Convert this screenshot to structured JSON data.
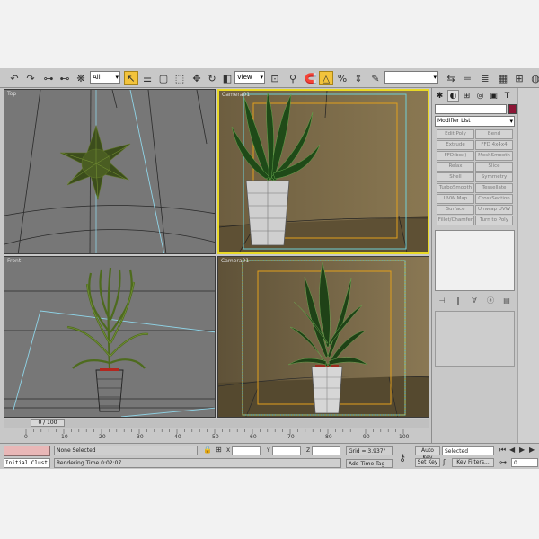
{
  "toolbar": {
    "selection_filter": "All",
    "reference_coord": "View",
    "named_selection": ""
  },
  "viewports": {
    "top": "Top",
    "camera_top": "Camera01",
    "front": "Front",
    "camera_bottom": "Camera01"
  },
  "command_panel": {
    "object_name": "",
    "modifier_list": "Modifier List",
    "modifier_buttons": [
      "Edit Poly",
      "Bend",
      "Extrude",
      "FFD 4x4x4",
      "FFD(box)",
      "MeshSmooth",
      "Relax",
      "Slice",
      "Shell",
      "Symmetry",
      "TurboSmooth",
      "Tessellate",
      "UVW Map",
      "CrossSection",
      "Surface",
      "Unwrap UVW",
      "Fillet/Chamfer",
      "Turn to Poly"
    ]
  },
  "timeline": {
    "frame_readout": "0 / 100",
    "ruler_ticks": [
      "0",
      "10",
      "20",
      "30",
      "40",
      "50",
      "60",
      "70",
      "80",
      "90",
      "100"
    ]
  },
  "status": {
    "selection_info": "None Selected",
    "prompt": "Rendering Time  0:02:07",
    "command_line": "Initial Clust",
    "x_label": "X",
    "y_label": "Y",
    "z_label": "Z",
    "x_value": "",
    "y_value": "",
    "z_value": "",
    "grid": "Grid = 3.937\"",
    "add_time_tag": "Add Time Tag",
    "auto_key": "Auto Key",
    "set_key": "Set Key",
    "selected_dropdown": "Selected",
    "key_filters": "Key Filters...",
    "current_frame": "0"
  },
  "colors": {
    "active_viewport_border": "#e8d826",
    "object_color": "#8c1535",
    "listener_bg": "#e9b7b7",
    "active_tool": "#f2c33c"
  }
}
